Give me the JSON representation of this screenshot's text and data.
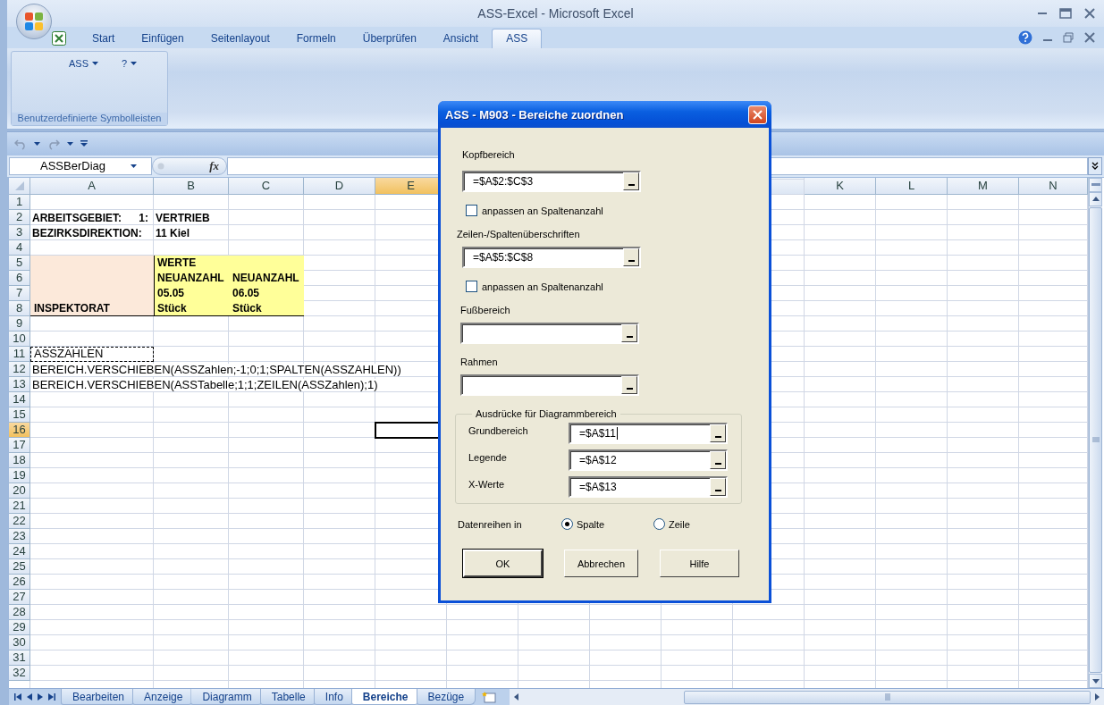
{
  "window": {
    "title": "ASS-Excel - Microsoft Excel"
  },
  "ribbon": {
    "tabs": [
      {
        "label": "Start",
        "selected": false
      },
      {
        "label": "Einfügen",
        "selected": false
      },
      {
        "label": "Seitenlayout",
        "selected": false
      },
      {
        "label": "Formeln",
        "selected": false
      },
      {
        "label": "Überprüfen",
        "selected": false
      },
      {
        "label": "Ansicht",
        "selected": false
      },
      {
        "label": "ASS",
        "selected": true
      }
    ],
    "group": {
      "label": "Benutzerdefinierte Symbolleisten",
      "buttons": [
        "ASS",
        "?"
      ]
    }
  },
  "formula_bar": {
    "name_box": "ASSBerDiag",
    "function_button": "fx"
  },
  "sheet": {
    "columns_left": [
      {
        "label": "A",
        "selected": false
      },
      {
        "label": "B",
        "selected": false
      },
      {
        "label": "C",
        "selected": false
      },
      {
        "label": "D",
        "selected": false
      },
      {
        "label": "E",
        "selected": true
      }
    ],
    "columns_right": [
      {
        "label": "K",
        "selected": false
      },
      {
        "label": "L",
        "selected": false
      },
      {
        "label": "M",
        "selected": false
      },
      {
        "label": "N",
        "selected": false
      }
    ],
    "rows": [
      {
        "label": "1",
        "selected": false
      },
      {
        "label": "2",
        "selected": false,
        "cells": [
          {
            "text": "ARBEITSGEBIET:",
            "right_text": "1:",
            "bold": true
          },
          {
            "text": "VERTRIEB",
            "bold": true
          }
        ]
      },
      {
        "label": "3",
        "selected": false,
        "cells": [
          {
            "text": "BEZIRKSDIREKTION:",
            "bold": true
          },
          {
            "text": "11 Kiel",
            "bold": true
          }
        ]
      },
      {
        "label": "4",
        "selected": false
      },
      {
        "label": "5",
        "selected": false,
        "cells": [
          {
            "color": "#fce9da"
          },
          {
            "text": "WERTE",
            "bold": true,
            "color": "#ffff99",
            "border_left": true
          },
          {
            "color": "#ffff99"
          }
        ]
      },
      {
        "label": "6",
        "selected": false,
        "cells": [
          {
            "color": "#fce9da"
          },
          {
            "text": "NEUANZAHL",
            "bold": true,
            "color": "#ffff99",
            "border_left": true
          },
          {
            "text": "NEUANZAHL",
            "bold": true,
            "color": "#ffff99"
          }
        ]
      },
      {
        "label": "7",
        "selected": false,
        "cells": [
          {
            "color": "#fce9da"
          },
          {
            "text": "05.05",
            "bold": true,
            "color": "#ffff99",
            "border_left": true
          },
          {
            "text": "06.05",
            "bold": true,
            "color": "#ffff99"
          }
        ]
      },
      {
        "label": "8",
        "selected": false,
        "cells": [
          {
            "text": "INSPEKTORAT",
            "bold": true,
            "color": "#fce9da",
            "border_bottom": true
          },
          {
            "text": "Stück",
            "bold": true,
            "color": "#ffff99",
            "border_left": true,
            "border_bottom": true
          },
          {
            "text": "Stück",
            "bold": true,
            "color": "#ffff99",
            "border_bottom": true
          }
        ]
      },
      {
        "label": "9",
        "selected": false
      },
      {
        "label": "10",
        "selected": false
      },
      {
        "label": "11",
        "selected": false,
        "cells": [
          {
            "text": "ASSZAHLEN",
            "marquee": true
          }
        ]
      },
      {
        "label": "12",
        "selected": false,
        "cells": [
          {
            "text": "BEREICH.VERSCHIEBEN(ASSZahlen;-1;0;1;SPALTEN(ASSZAHLEN))"
          }
        ]
      },
      {
        "label": "13",
        "selected": false,
        "cells": [
          {
            "text": "BEREICH.VERSCHIEBEN(ASSTabelle;1;1;ZEILEN(ASSZahlen);1)"
          }
        ]
      },
      {
        "label": "14",
        "selected": false
      },
      {
        "label": "15",
        "selected": false
      },
      {
        "label": "16",
        "selected": true
      },
      {
        "label": "17",
        "selected": false
      },
      {
        "label": "18",
        "selected": false
      },
      {
        "label": "19",
        "selected": false
      },
      {
        "label": "20",
        "selected": false
      },
      {
        "label": "21",
        "selected": false
      },
      {
        "label": "22",
        "selected": false
      },
      {
        "label": "23",
        "selected": false
      },
      {
        "label": "24",
        "selected": false
      },
      {
        "label": "25",
        "selected": false
      },
      {
        "label": "26",
        "selected": false
      },
      {
        "label": "27",
        "selected": false
      },
      {
        "label": "28",
        "selected": false
      },
      {
        "label": "29",
        "selected": false
      },
      {
        "label": "30",
        "selected": false
      },
      {
        "label": "31",
        "selected": false
      },
      {
        "label": "32",
        "selected": false
      }
    ]
  },
  "sheet_tabs": [
    {
      "label": "Bearbeiten",
      "selected": false
    },
    {
      "label": "Anzeige",
      "selected": false
    },
    {
      "label": "Diagramm",
      "selected": false
    },
    {
      "label": "Tabelle",
      "selected": false
    },
    {
      "label": "Info",
      "selected": false
    },
    {
      "label": "Bereiche",
      "selected": true
    },
    {
      "label": "Bezüge",
      "selected": false
    }
  ],
  "dialog": {
    "title": "ASS - M903 - Bereiche zuordnen",
    "items": [
      {
        "kind": "field",
        "label": "Kopfbereich",
        "value": "=$A$2:$C$3"
      },
      {
        "kind": "checkbox",
        "label": "anpassen an Spaltenanzahl",
        "checked": false
      },
      {
        "kind": "field",
        "label": "Zeilen-/Spaltenüberschriften",
        "value": "=$A$5:$C$8"
      },
      {
        "kind": "checkbox",
        "label": "anpassen an Spaltenanzahl",
        "checked": false
      },
      {
        "kind": "field",
        "label": "Fußbereich"
      },
      {
        "kind": "field",
        "label": "Rahmen"
      }
    ],
    "group": {
      "title": "Ausdrücke für Diagrammbereich",
      "rows": [
        {
          "label": "Grundbereich",
          "value": "=$A$11",
          "focused": true
        },
        {
          "label": "Legende",
          "value": "=$A$12",
          "focused": false
        },
        {
          "label": "X-Werte",
          "value": "=$A$13",
          "focused": false
        }
      ]
    },
    "radio": {
      "label": "Datenreihen in",
      "options": [
        {
          "label": "Spalte",
          "selected": true
        },
        {
          "label": "Zeile",
          "selected": false
        }
      ]
    },
    "buttons": [
      {
        "label": "OK",
        "default": true
      },
      {
        "label": "Abbrechen",
        "default": false
      },
      {
        "label": "Hilfe",
        "default": false
      }
    ]
  }
}
